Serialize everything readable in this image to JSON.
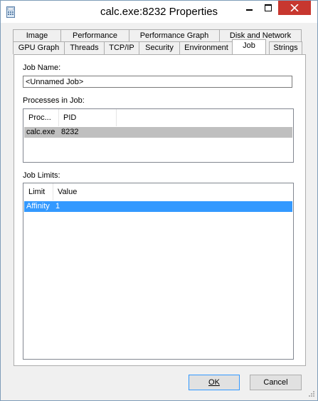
{
  "window": {
    "title": "calc.exe:8232 Properties"
  },
  "tabs": {
    "row1": [
      "Image",
      "Performance",
      "Performance Graph",
      "Disk and Network"
    ],
    "row2": [
      "GPU Graph",
      "Threads",
      "TCP/IP",
      "Security",
      "Environment",
      "Job",
      "Strings"
    ],
    "active": "Job"
  },
  "job": {
    "name_label": "Job Name:",
    "name_value": "<Unnamed Job>",
    "processes_label": "Processes in Job:",
    "processes_columns": [
      "Proc...",
      "PID"
    ],
    "processes_rows": [
      {
        "process": "calc.exe",
        "pid": "8232"
      }
    ],
    "limits_label": "Job Limits:",
    "limits_columns": [
      "Limit",
      "Value"
    ],
    "limits_rows": [
      {
        "limit": "Affinity",
        "value": "1"
      }
    ]
  },
  "buttons": {
    "ok": "OK",
    "cancel": "Cancel"
  },
  "colors": {
    "selected_row": "#3399ff",
    "inactive_selection": "#bfbfbf",
    "close_button": "#c7372f"
  }
}
